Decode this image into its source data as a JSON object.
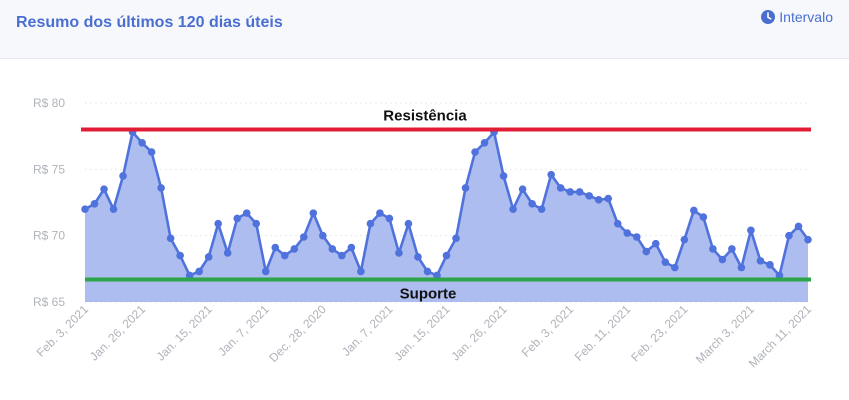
{
  "header": {
    "title": "Resumo dos últimos 120 dias úteis",
    "interval_label": "Intervalo",
    "interval_icon": "clock-icon"
  },
  "colors": {
    "accent": "#4a6fd1",
    "line": "#5072dc",
    "fill": "#a9b9ee",
    "resistance": "#e11d35",
    "support": "#2ca44a"
  },
  "chart_data": {
    "type": "area",
    "ylim": [
      65,
      80
    ],
    "y_ticks": [
      {
        "value": 80,
        "label": "R$ 80"
      },
      {
        "value": 75,
        "label": "R$ 75"
      },
      {
        "value": 70,
        "label": "R$ 70"
      },
      {
        "value": 65,
        "label": "R$ 65"
      }
    ],
    "x_tick_labels": [
      "Feb. 3, 2021",
      "Jan. 26, 2021",
      "Jan. 15, 2021",
      "Jan. 7, 2021",
      "Dec. 28, 2020",
      "Jan. 7, 2021",
      "Jan. 15, 2021",
      "Jan. 26, 2021",
      "Feb. 3, 2021",
      "Feb. 11, 2021",
      "Feb. 23, 2021",
      "March 3, 2021",
      "March 11, 2021"
    ],
    "values": [
      72.0,
      72.4,
      73.5,
      72.0,
      74.5,
      77.8,
      77.0,
      76.3,
      73.6,
      69.8,
      68.5,
      67.0,
      67.3,
      68.4,
      70.9,
      68.7,
      71.3,
      71.7,
      70.9,
      67.3,
      69.1,
      68.5,
      69.0,
      69.9,
      71.7,
      70.0,
      69.0,
      68.5,
      69.1,
      67.3,
      70.9,
      71.7,
      71.3,
      68.7,
      70.9,
      68.4,
      67.3,
      67.0,
      68.5,
      69.8,
      73.6,
      76.3,
      77.0,
      77.8,
      74.5,
      72.0,
      73.5,
      72.4,
      72.0,
      74.6,
      73.6,
      73.3,
      73.3,
      73.0,
      72.7,
      72.8,
      70.9,
      70.2,
      69.9,
      68.8,
      69.4,
      68.0,
      67.6,
      69.7,
      71.9,
      71.4,
      69.0,
      68.2,
      69.0,
      67.6,
      70.4,
      68.1,
      67.8,
      67.0,
      70.0,
      70.7,
      69.7
    ],
    "annotations": [
      {
        "label": "Resistência",
        "value": 78.0
      },
      {
        "label": "Suporte",
        "value": 66.7
      }
    ]
  }
}
